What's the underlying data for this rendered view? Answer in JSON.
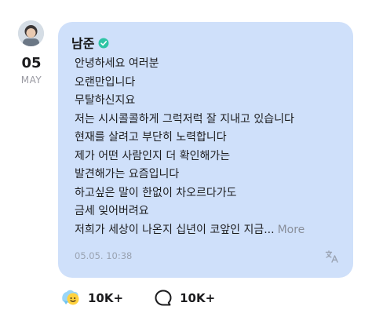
{
  "post": {
    "date_day": "05",
    "date_month": "MAY",
    "author": "남준",
    "lines": [
      "안녕하세요 여러분",
      "오랜만입니다",
      "무탈하신지요",
      "저는 시시콜콜하게 그럭저럭 잘 지내고 있습니다",
      "현재를 살려고 부단히 노력합니다",
      "제가 어떤 사람인지 더 확인해가는",
      "발견해가는 요즘입니다",
      "하고싶은 말이 한없이 차오르다가도",
      "금세 잊어버려요",
      "저희가 세상이 나온지 십년이 코앞인 지금..."
    ],
    "more_label": "More",
    "timestamp": "05.05. 10:38"
  },
  "footer": {
    "like_count": "10K+",
    "comment_count": "10K+"
  },
  "colors": {
    "bubble": "#cfe0fa",
    "verified": "#2ec4a5"
  },
  "icons": {
    "verified": "verified-badge-icon",
    "translate": "translate-icon",
    "like": "like-reaction-icon",
    "comment": "comment-bubble-icon"
  }
}
